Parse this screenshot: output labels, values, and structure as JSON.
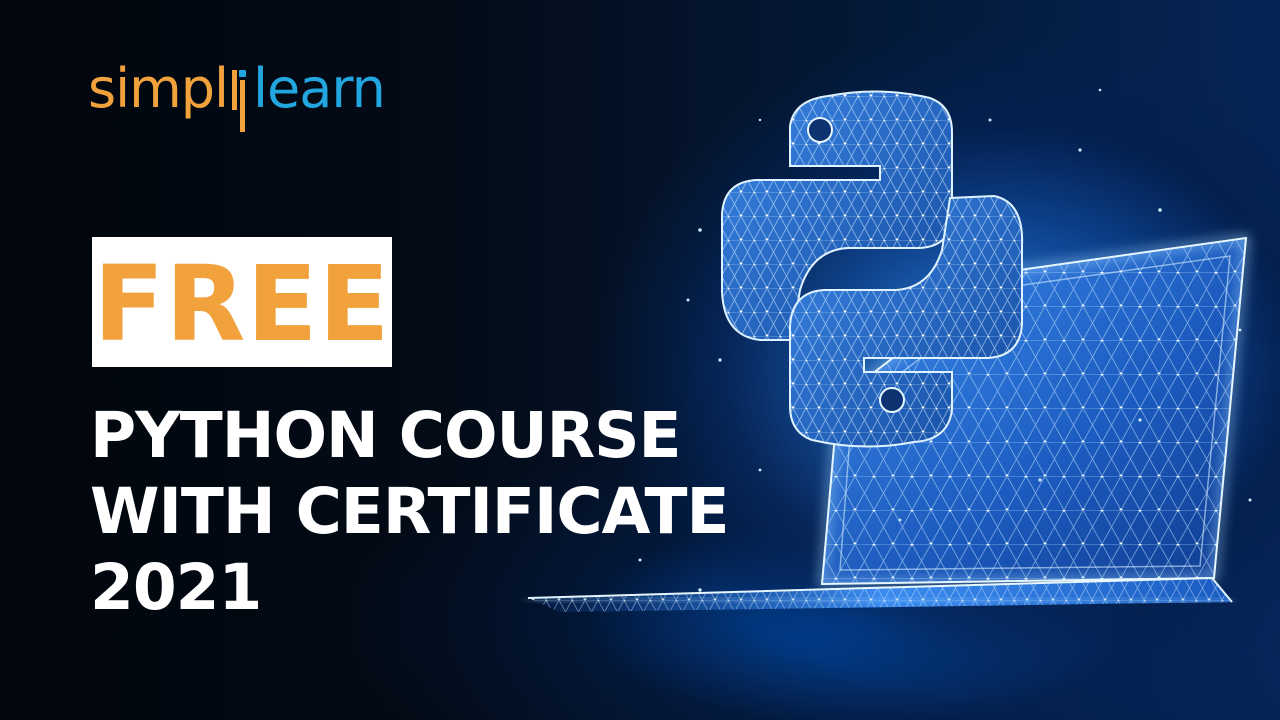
{
  "logo": {
    "part1": "simpl",
    "part2": "learn",
    "colors": {
      "primary": "#f2a23c",
      "secondary": "#22a6df"
    }
  },
  "badge": {
    "label": "FREE",
    "colors": {
      "background": "#ffffff",
      "text": "#f2a23c"
    }
  },
  "headline": {
    "line1": "PYTHON COURSE",
    "line2": "WITH CERTIFICATE",
    "line3": "2021",
    "color": "#ffffff"
  },
  "artwork": {
    "icons": [
      "python-logo-icon",
      "laptop-icon"
    ],
    "accent_color": "#2f9bff"
  }
}
